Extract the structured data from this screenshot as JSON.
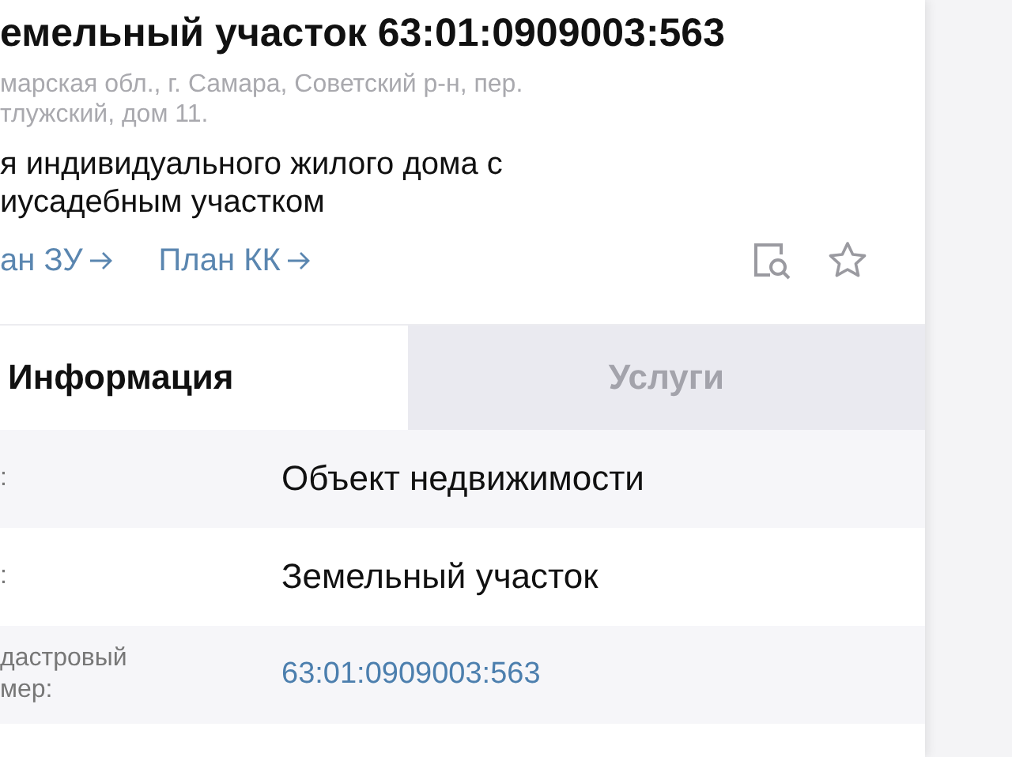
{
  "header": {
    "title": "емельный участок 63:01:0909003:563",
    "address": "марская обл., г. Самара, Советский р-н, пер.\nтлужский, дом 11.",
    "description": "я индивидуального жилого дома с\nиусадебным участком"
  },
  "links": [
    {
      "label": "ан ЗУ"
    },
    {
      "label": "План КК"
    }
  ],
  "tabs": [
    {
      "label": "Информация",
      "selected": true
    },
    {
      "label": "Услуги",
      "selected": false
    }
  ],
  "rows": [
    {
      "label": ":",
      "value": "Объект недвижимости",
      "kind": "text"
    },
    {
      "label": ":",
      "value": "Земельный участок",
      "kind": "text"
    },
    {
      "label": "дастровый\nмер:",
      "value": "63:01:0909003:563",
      "kind": "link"
    }
  ]
}
